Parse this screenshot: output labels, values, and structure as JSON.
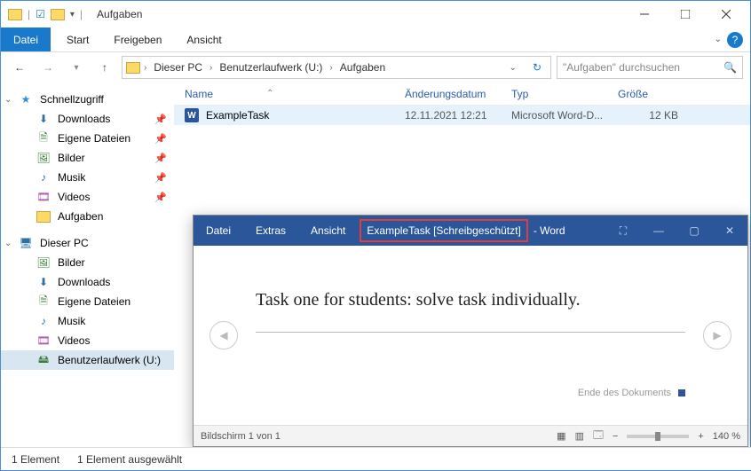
{
  "window": {
    "title": "Aufgaben",
    "qat_sep": "|"
  },
  "ribbon": {
    "file": "Datei",
    "tab_start": "Start",
    "tab_share": "Freigeben",
    "tab_view": "Ansicht"
  },
  "address": {
    "crumbs": [
      "Dieser PC",
      "Benutzerlaufwerk (U:)",
      "Aufgaben"
    ],
    "search_placeholder": "\"Aufgaben\" durchsuchen"
  },
  "sidebar": {
    "quick": "Schnellzugriff",
    "quick_items": [
      {
        "label": "Downloads",
        "icon": "dl"
      },
      {
        "label": "Eigene Dateien",
        "icon": "doc"
      },
      {
        "label": "Bilder",
        "icon": "pic"
      },
      {
        "label": "Musik",
        "icon": "music"
      },
      {
        "label": "Videos",
        "icon": "video"
      },
      {
        "label": "Aufgaben",
        "icon": "folder"
      }
    ],
    "pc": "Dieser PC",
    "pc_items": [
      {
        "label": "Bilder",
        "icon": "pic"
      },
      {
        "label": "Downloads",
        "icon": "dl"
      },
      {
        "label": "Eigene Dateien",
        "icon": "doc"
      },
      {
        "label": "Musik",
        "icon": "music"
      },
      {
        "label": "Videos",
        "icon": "video"
      },
      {
        "label": "Benutzerlaufwerk (U:)",
        "icon": "drive",
        "selected": true
      }
    ]
  },
  "columns": {
    "name": "Name",
    "date": "Änderungsdatum",
    "type": "Typ",
    "size": "Größe"
  },
  "rows": [
    {
      "name": "ExampleTask",
      "date": "12.11.2021 12:21",
      "type": "Microsoft Word-D...",
      "size": "12 KB"
    }
  ],
  "word": {
    "tab_file": "Datei",
    "tab_extras": "Extras",
    "tab_view": "Ansicht",
    "doc_title": "ExampleTask [Schreibgeschützt]",
    "title_suffix": "- Word",
    "body": "Task one for students: solve task individually.",
    "end": "Ende des Dokuments",
    "status_page": "Bildschirm 1 von 1",
    "zoom_minus": "−",
    "zoom_plus": "+",
    "zoom": "140 %"
  },
  "status": {
    "count": "1 Element",
    "selected": "1 Element ausgewählt"
  }
}
